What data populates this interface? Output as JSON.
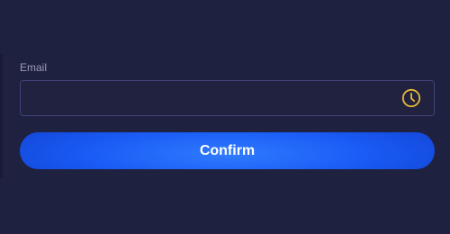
{
  "form": {
    "email_label": "Email",
    "email_value": "",
    "email_placeholder": "",
    "field_icon": "clock-icon",
    "confirm_label": "Confirm"
  },
  "colors": {
    "background": "#1f2140",
    "field_border": "#40437a",
    "icon_accent": "#e6b93a",
    "button_primary": "#1a5cf5"
  }
}
